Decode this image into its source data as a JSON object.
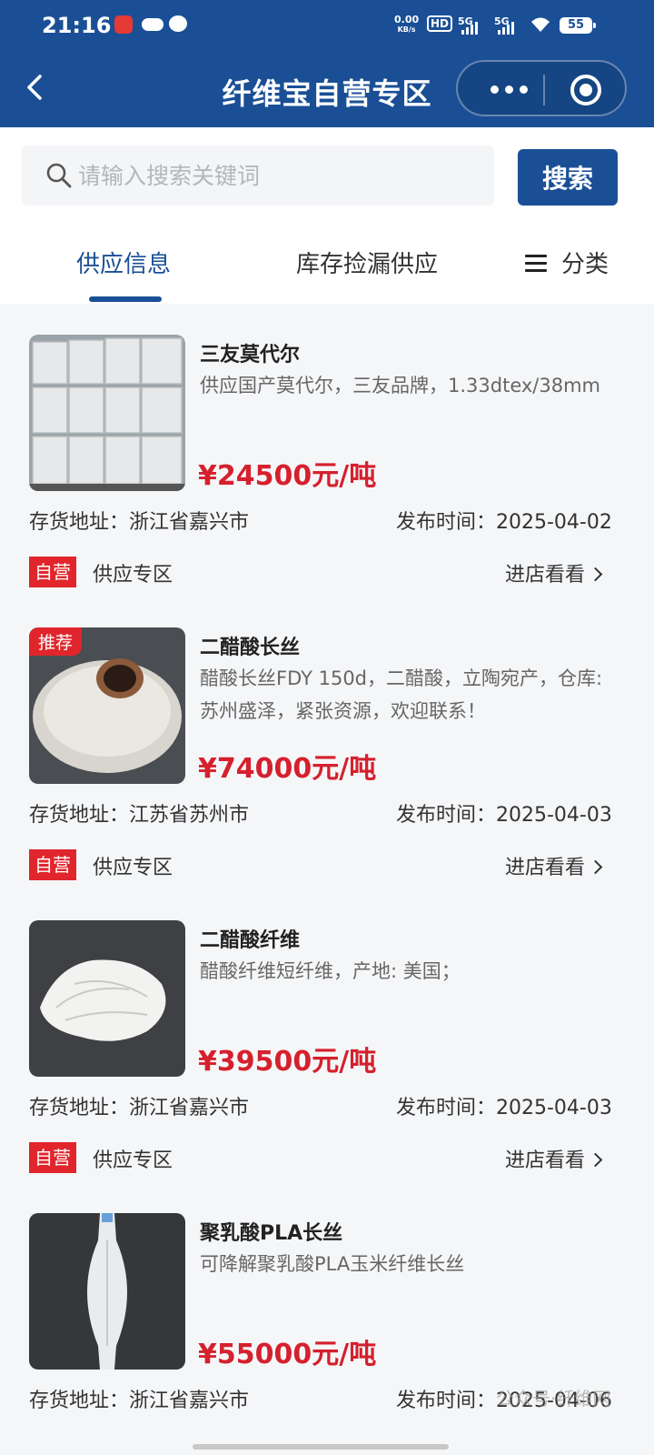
{
  "status_bar": {
    "time": "21:16",
    "net_speed_top": "0.00",
    "net_speed_bottom": "KB/s",
    "hd": "HD",
    "sig1": "5G",
    "sig2": "5G",
    "battery": "55"
  },
  "nav": {
    "title": "纤维宝自营专区"
  },
  "search": {
    "placeholder": "请输入搜索关键词",
    "button_label": "搜索"
  },
  "tabs": [
    {
      "label": "供应信息"
    },
    {
      "label": "库存捡漏供应"
    }
  ],
  "category_label": "分类",
  "products": [
    {
      "title": "三友莫代尔",
      "description": "供应国产莫代尔，三友品牌，1.33dtex/38mm",
      "price": "¥24500元/吨",
      "address_label": "存货地址：浙江省嘉兴市",
      "date_label": "发布时间：2025-04-02",
      "tag": "自营",
      "zone": "供应专区",
      "enter": "进店看看",
      "badge": ""
    },
    {
      "title": "二醋酸长丝",
      "description": "醋酸长丝FDY 150d，二醋酸，立陶宛产，仓库: 苏州盛泽，紧张资源，欢迎联系！",
      "price": "¥74000元/吨",
      "address_label": "存货地址：江苏省苏州市",
      "date_label": "发布时间：2025-04-03",
      "tag": "自营",
      "zone": "供应专区",
      "enter": "进店看看",
      "badge": "推荐"
    },
    {
      "title": "二醋酸纤维",
      "description": "醋酸纤维短纤维，产地: 美国；",
      "price": "¥39500元/吨",
      "address_label": "存货地址：浙江省嘉兴市",
      "date_label": "发布时间：2025-04-03",
      "tag": "自营",
      "zone": "供应专区",
      "enter": "进店看看",
      "badge": ""
    },
    {
      "title": "聚乳酸PLA长丝",
      "description": "可降解聚乳酸PLA玉米纤维长丝",
      "price": "¥55000元/吨",
      "address_label": "存货地址：浙江省嘉兴市",
      "date_label": "发布时间：2025-04-06",
      "tag": "",
      "zone": "",
      "enter": "",
      "badge": ""
    }
  ],
  "watermark": "公众号·纤维网"
}
